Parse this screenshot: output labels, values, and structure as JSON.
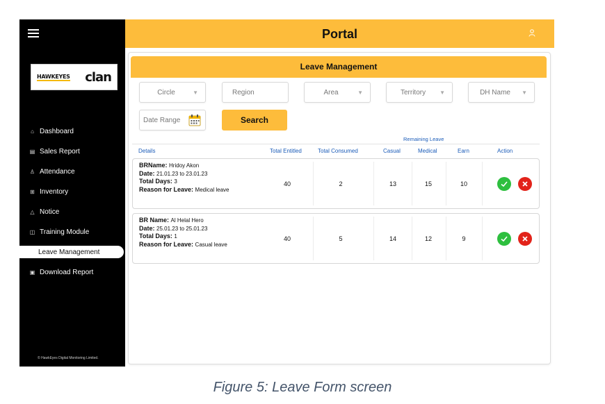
{
  "top_text": "",
  "portal": {
    "title": "Portal"
  },
  "logo": {
    "brand_left": "HAWKEYES",
    "brand_right": "clan"
  },
  "sidebar": {
    "items": [
      {
        "label": "Dashboard",
        "icon": "home-icon"
      },
      {
        "label": "Sales Report",
        "icon": "chart-icon"
      },
      {
        "label": "Attendance",
        "icon": "person-icon"
      },
      {
        "label": "Inventory",
        "icon": "box-icon"
      },
      {
        "label": "Notice",
        "icon": "bell-icon"
      },
      {
        "label": "Training Module",
        "icon": "training-icon"
      },
      {
        "label": "Leave Management",
        "icon": "",
        "active": true
      },
      {
        "label": "Download Report",
        "icon": "download-icon"
      }
    ],
    "copyright": "© HawkEyes Digital Monitoring Limited."
  },
  "page": {
    "title": "Leave Management"
  },
  "filters": {
    "circle": "Circle",
    "region": "Region",
    "area": "Area",
    "territory": "Territory",
    "dh_name": "DH Name",
    "date_range": "Date Range",
    "search": "Search"
  },
  "table": {
    "remaining_label": "Remaining Leave",
    "headers": {
      "details": "Details",
      "total_entitled": "Total Entitled",
      "total_consumed": "Total Consumed",
      "casual": "Casual",
      "medical": "Medical",
      "earn": "Earn",
      "action": "Action"
    },
    "rows": [
      {
        "name_label": "BRName:",
        "name": "Hridoy Akon",
        "date_label": "Date:",
        "date": "21.01.23 to 23.01.23",
        "days_label": "Total Days:",
        "days": "3",
        "reason_label": "Reason for Leave:",
        "reason": "Medical leave",
        "total_entitled": "40",
        "total_consumed": "2",
        "casual": "13",
        "medical": "15",
        "earn": "10"
      },
      {
        "name_label": "BR Name:",
        "name": "Al Helal Hero",
        "date_label": "Date:",
        "date": "25.01.23 to 25.01.23",
        "days_label": "Total Days:",
        "days": "1",
        "reason_label": "Reason for Leave:",
        "reason": "Casual leave",
        "total_entitled": "40",
        "total_consumed": "5",
        "casual": "14",
        "medical": "12",
        "earn": "9"
      }
    ]
  },
  "caption": "Figure 5: Leave Form screen",
  "colors": {
    "accent": "#fdbc3b",
    "sidebar": "#000000",
    "approve": "#2ebf3f",
    "reject": "#e2231a",
    "header_text": "#1a5bb8"
  }
}
